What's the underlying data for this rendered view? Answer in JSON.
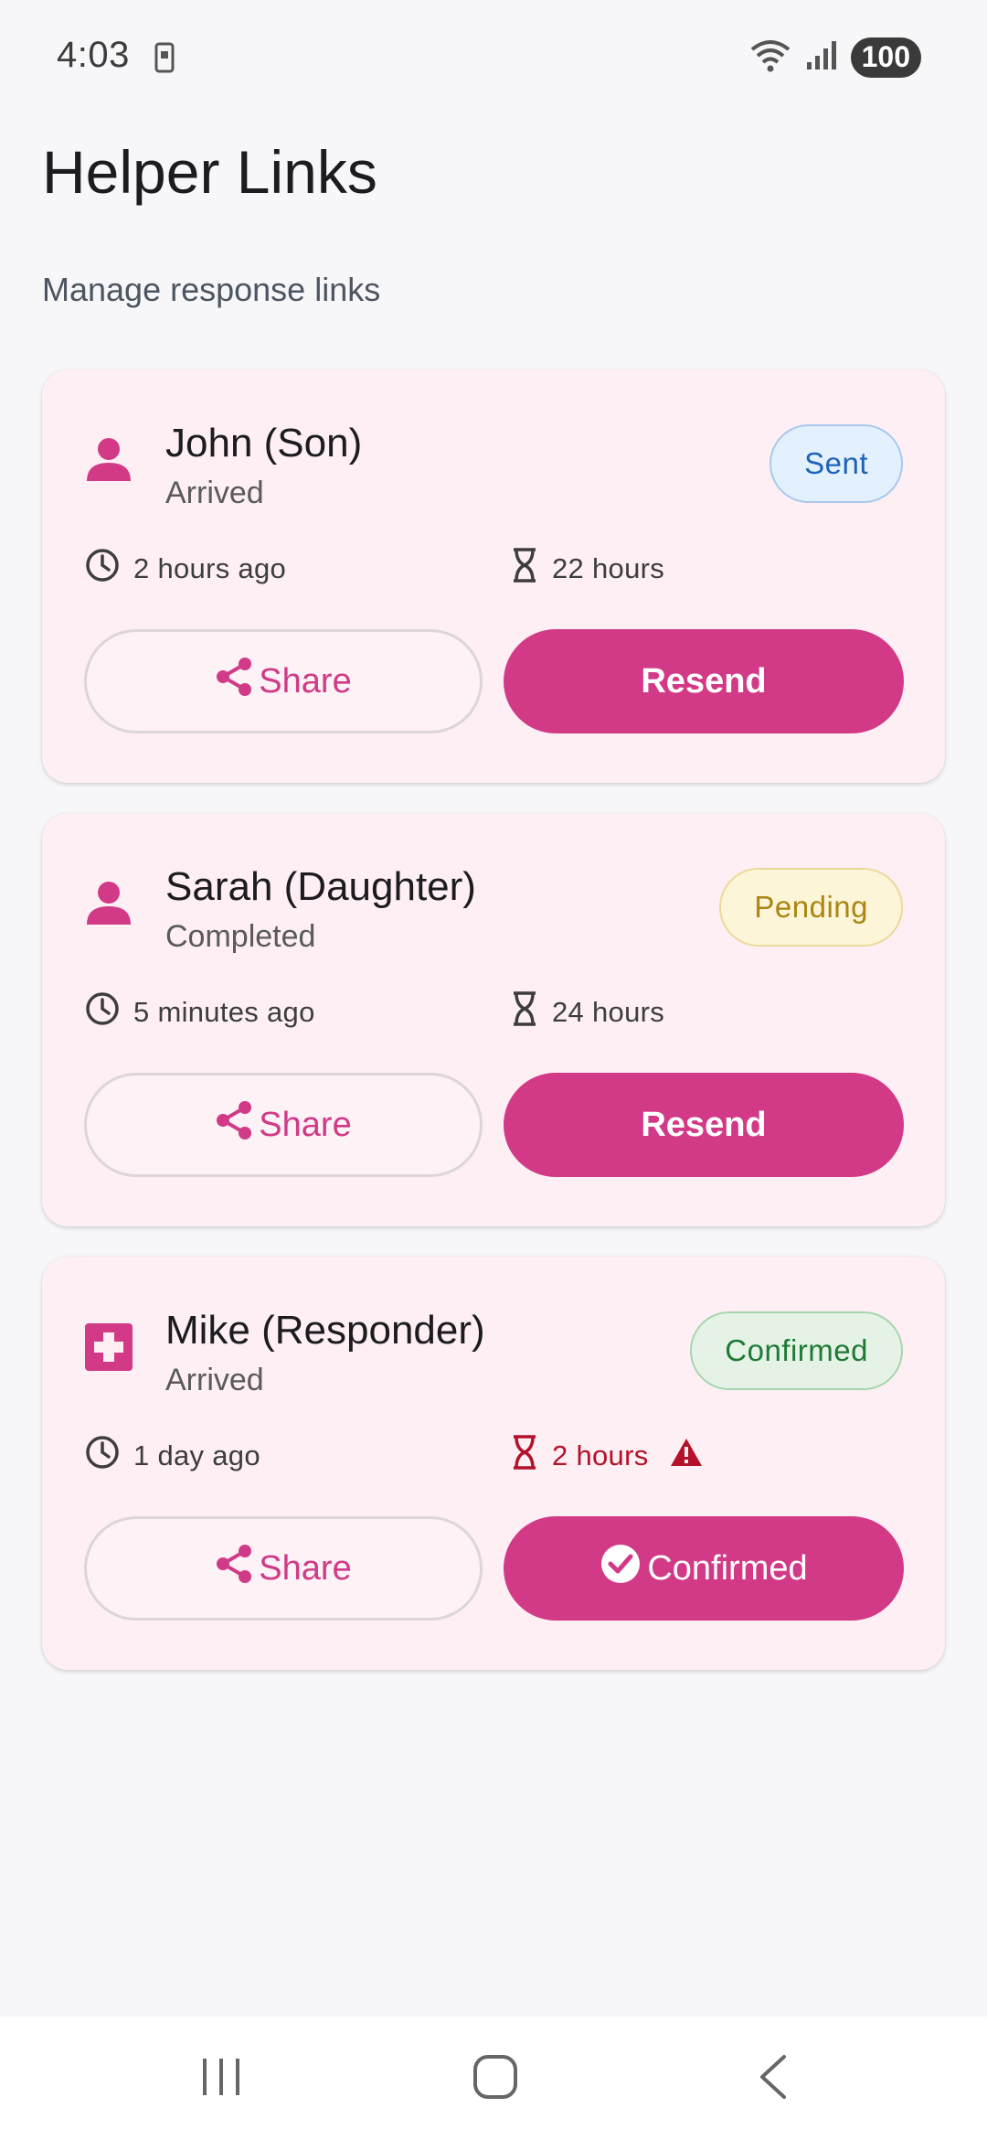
{
  "status_bar": {
    "time": "4:03",
    "battery": "100"
  },
  "header": {
    "title": "Helper Links",
    "subtitle": "Manage response links"
  },
  "cards": [
    {
      "name": "John (Son)",
      "status": "Arrived",
      "badge": "Sent",
      "badge_color": "#1f63b8",
      "time_ago": "2 hours ago",
      "remaining": "22 hours",
      "share_label": "Share",
      "action_label": "Resend",
      "avatar_icon": "person-icon"
    },
    {
      "name": "Sarah (Daughter)",
      "status": "Completed",
      "badge": "Pending",
      "badge_color": "#a98611",
      "time_ago": "5 minutes ago",
      "remaining": "24 hours",
      "share_label": "Share",
      "action_label": "Resend",
      "avatar_icon": "person-icon"
    },
    {
      "name": "Mike (Responder)",
      "status": "Arrived",
      "badge": "Confirmed",
      "badge_color": "#1e7a34",
      "time_ago": "1 day ago",
      "remaining": "2 hours",
      "share_label": "Share",
      "action_label": "Confirmed",
      "avatar_icon": "medical-cross-icon",
      "warning_icon": "warning-icon"
    }
  ],
  "colors": {
    "accent": "#d23a87",
    "card_bg": "#fdeff4",
    "warning": "#b3122a"
  }
}
